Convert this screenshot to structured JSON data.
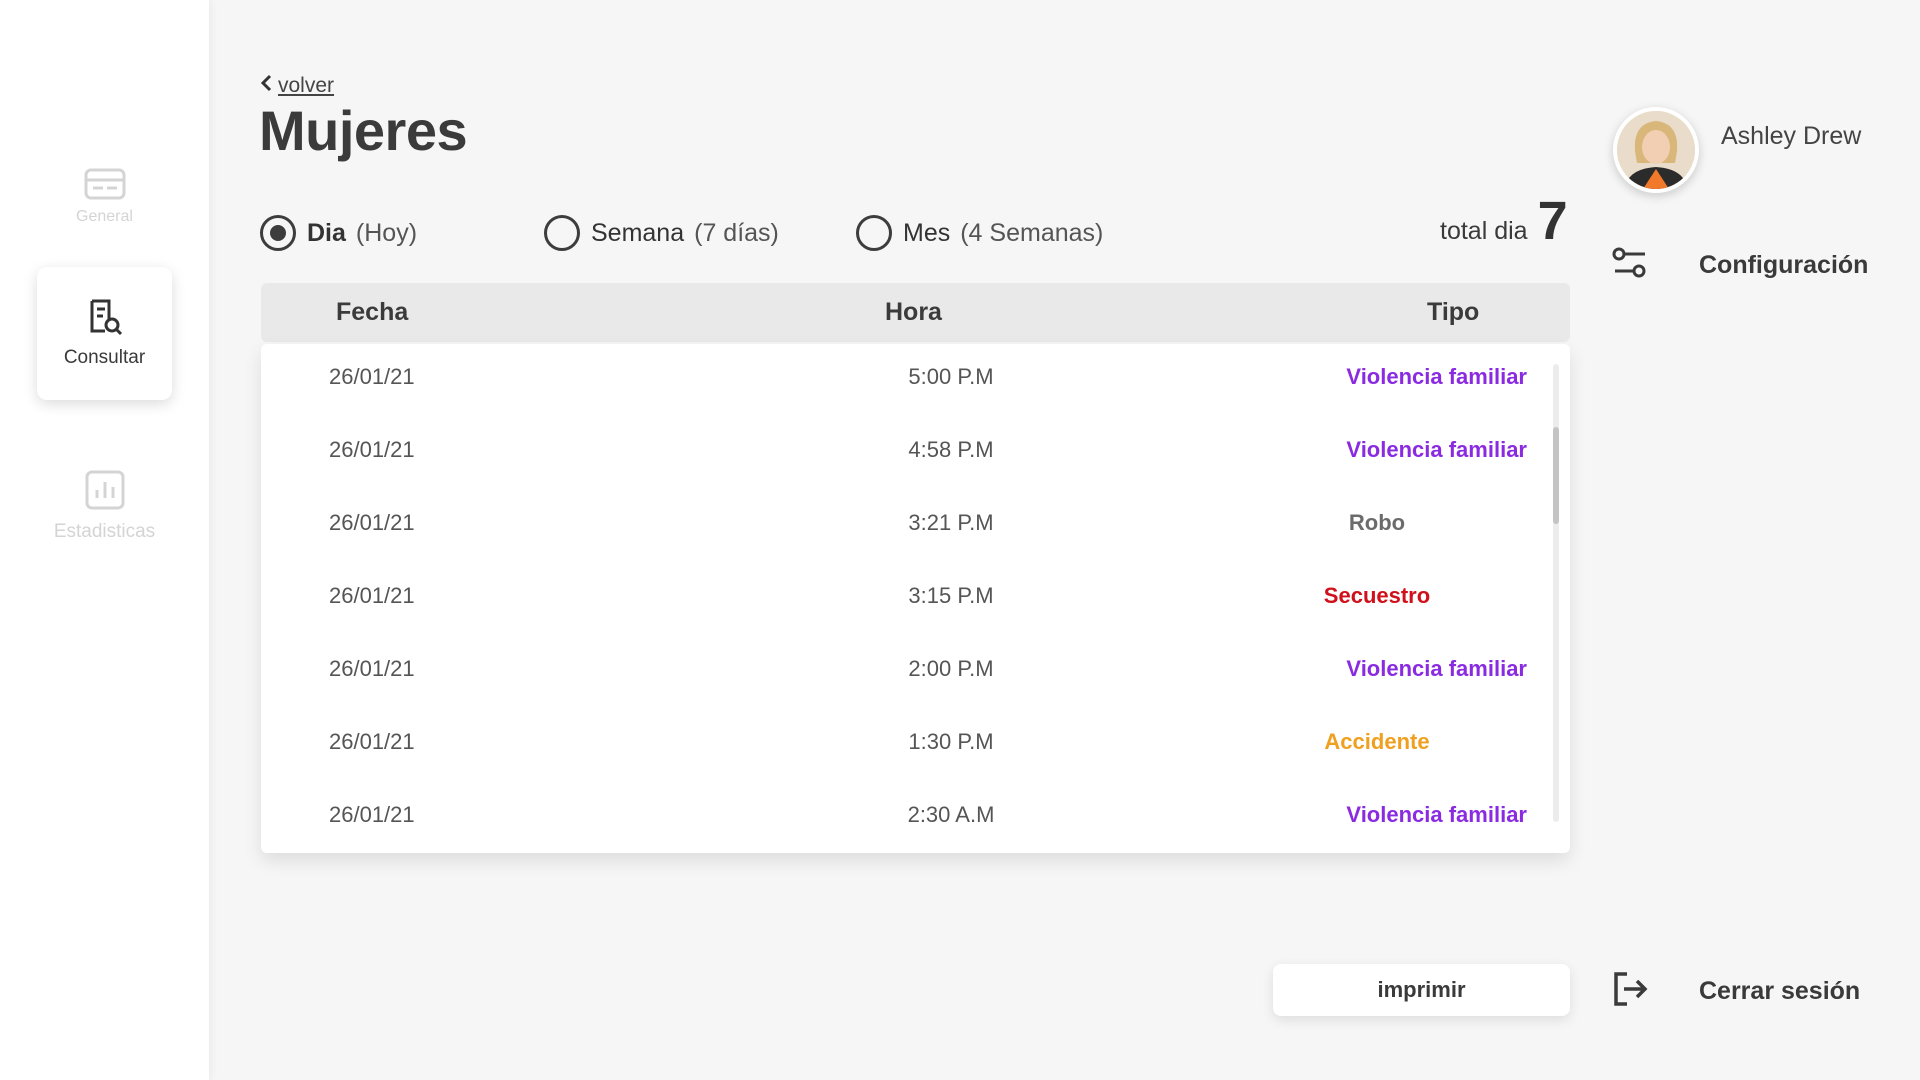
{
  "sidebar": {
    "items": [
      {
        "label": "General",
        "icon": "card-icon",
        "state": "disabled"
      },
      {
        "label": "Consultar",
        "icon": "document-search-icon",
        "state": "active"
      },
      {
        "label": "Estadisticas",
        "icon": "bar-chart-icon",
        "state": "disabled"
      }
    ]
  },
  "header": {
    "back_label": "volver",
    "title": "Mujeres"
  },
  "filters": [
    {
      "label": "Dia",
      "detail": "(Hoy)",
      "checked": true
    },
    {
      "label": "Semana",
      "detail": "(7 días)",
      "checked": false
    },
    {
      "label": "Mes",
      "detail": "(4 Semanas)",
      "checked": false
    }
  ],
  "total": {
    "label": "total dia",
    "value": "7"
  },
  "table": {
    "columns": [
      "Fecha",
      "Hora",
      "Tipo"
    ],
    "rows": [
      {
        "fecha": "26/01/21",
        "hora": "5:00 P.M",
        "tipo": "Violencia familiar",
        "color": "#8a2be2"
      },
      {
        "fecha": "26/01/21",
        "hora": "4:58 P.M",
        "tipo": "Violencia familiar",
        "color": "#8a2be2"
      },
      {
        "fecha": "26/01/21",
        "hora": "3:21 P.M",
        "tipo": "Robo",
        "color": "#6b6b6b"
      },
      {
        "fecha": "26/01/21",
        "hora": "3:15 P.M",
        "tipo": "Secuestro",
        "color": "#d0101a"
      },
      {
        "fecha": "26/01/21",
        "hora": "2:00 P.M",
        "tipo": "Violencia familiar",
        "color": "#8a2be2"
      },
      {
        "fecha": "26/01/21",
        "hora": "1:30 P.M",
        "tipo": "Accidente",
        "color": "#f0a020"
      },
      {
        "fecha": "26/01/21",
        "hora": "2:30 A.M",
        "tipo": "Violencia familiar",
        "color": "#8a2be2"
      }
    ]
  },
  "user": {
    "name": "Ashley Drew"
  },
  "menu": {
    "config_label": "Configuración",
    "logout_label": "Cerrar sesión"
  },
  "actions": {
    "print_label": "imprimir"
  }
}
